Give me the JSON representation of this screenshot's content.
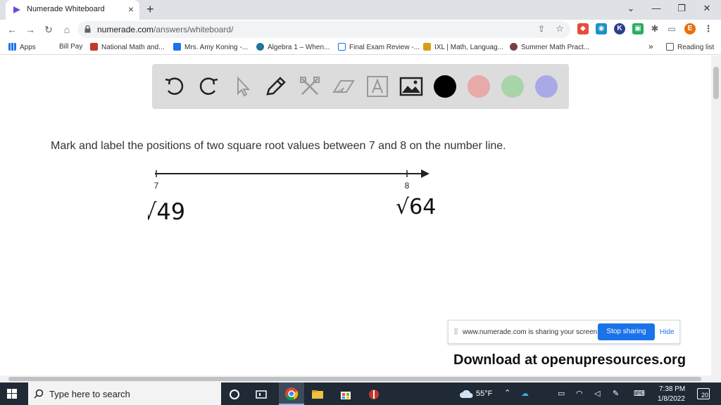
{
  "browser": {
    "tab_title": "Numerade Whiteboard",
    "tab_close": "×",
    "new_tab": "+",
    "url_host": "numerade.com",
    "url_path": "/answers/whiteboard/",
    "profile_initial": "E"
  },
  "bookmarks": [
    {
      "label": "Apps",
      "icon": "apps-grid-icon",
      "color": "#1a73e8"
    },
    {
      "label": "Bill Pay",
      "icon": "none",
      "color": ""
    },
    {
      "label": "National Math and...",
      "icon": "nm-icon",
      "color": "#c0392b"
    },
    {
      "label": "Mrs. Amy Koning -...",
      "icon": "calendar-icon",
      "color": "#1a73e8"
    },
    {
      "label": "Algebra 1 – When...",
      "icon": "wordpress-icon",
      "color": "#21759b"
    },
    {
      "label": "Final Exam Review -...",
      "icon": "doc-icon",
      "color": "#1a73e8"
    },
    {
      "label": "IXL | Math, Languag...",
      "icon": "ixl-icon",
      "color": "#d4a017"
    },
    {
      "label": "Summer Math Pract...",
      "icon": "circle-logo-icon",
      "color": "#7b3f3f"
    }
  ],
  "bookmarks_more": "»",
  "reading_list": "Reading list",
  "whiteboard": {
    "colors": [
      "#000000",
      "#e8a9a9",
      "#a9d4a9",
      "#a9a9e8"
    ]
  },
  "question": "Mark and label the positions of two square root values between 7 and 8 on the number line.",
  "number_line": {
    "left_tick": "7",
    "right_tick": "8",
    "left_annotation": "√49",
    "right_annotation": "√64"
  },
  "share_bar": {
    "message": "www.numerade.com is sharing your screen.",
    "stop_label": "Stop sharing",
    "hide_label": "Hide"
  },
  "download_banner": "Download at openupresources.org",
  "taskbar": {
    "search_placeholder": "Type here to search",
    "weather": "55°F",
    "time": "7:38 PM",
    "date": "1/8/2022",
    "notifications": "20"
  }
}
